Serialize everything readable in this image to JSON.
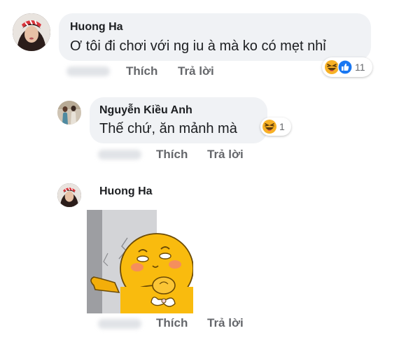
{
  "comments": [
    {
      "author": "Huong Ha",
      "text": "Ơ tôi đi chơi với ng iu à mà ko có mẹt nhỉ",
      "like_label": "Thích",
      "reply_label": "Trả lời",
      "reactions": [
        "haha-icon",
        "like-icon"
      ],
      "reaction_count": "11"
    },
    {
      "author": "Nguyễn Kiều Anh",
      "text": "Thế chứ, ăn mảnh mà",
      "like_label": "Thích",
      "reply_label": "Trả lời",
      "reactions": [
        "haha-icon"
      ],
      "reaction_count": "1"
    },
    {
      "author": "Huong Ha",
      "sticker": "peeking-yellow-blob-sticker",
      "like_label": "Thích",
      "reply_label": "Trả lời"
    }
  ],
  "colors": {
    "bubble": "#f0f2f5",
    "meta_text": "#65676b",
    "like_blue": "#1877f2",
    "haha_yellow": "#f7b125"
  }
}
